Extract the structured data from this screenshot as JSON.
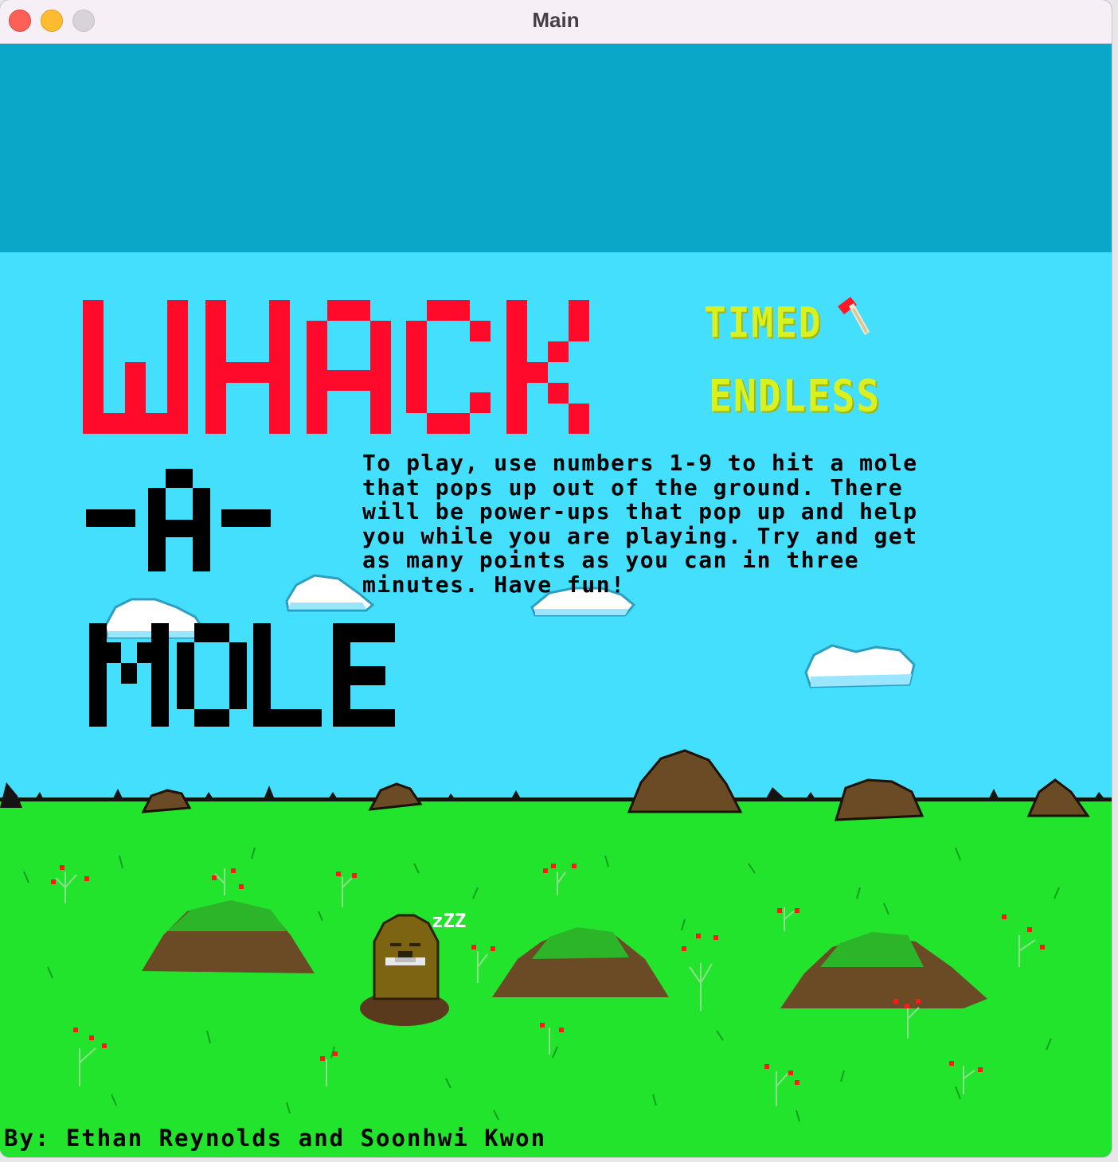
{
  "window": {
    "title": "Main"
  },
  "game": {
    "title_lines": [
      "WHACK",
      "-A-",
      "MOLE"
    ],
    "title_colors": {
      "whack": "#ff0a2a",
      "mole": "#000000"
    },
    "modes": {
      "timed": "TIMED",
      "endless": "ENDLESS",
      "selected_icon": "hammer-icon"
    },
    "instructions_lines": [
      "To play, use numbers 1-9 to hit a mole",
      "that pops up out of the ground. There",
      "will be power-ups that pop up and help",
      "you while you are playing. Try and get",
      "as many points as you can in three",
      "minutes. Have fun!"
    ],
    "credits": "By: Ethan Reynolds and Soonhwi Kwon",
    "sleep_text": "zZZ",
    "colors": {
      "sky": "#45dffe",
      "upper_band": "#0aa7c8",
      "grass": "#22e42c",
      "dirt": "#6b4a26",
      "mode_text": "#d9f11f"
    }
  }
}
